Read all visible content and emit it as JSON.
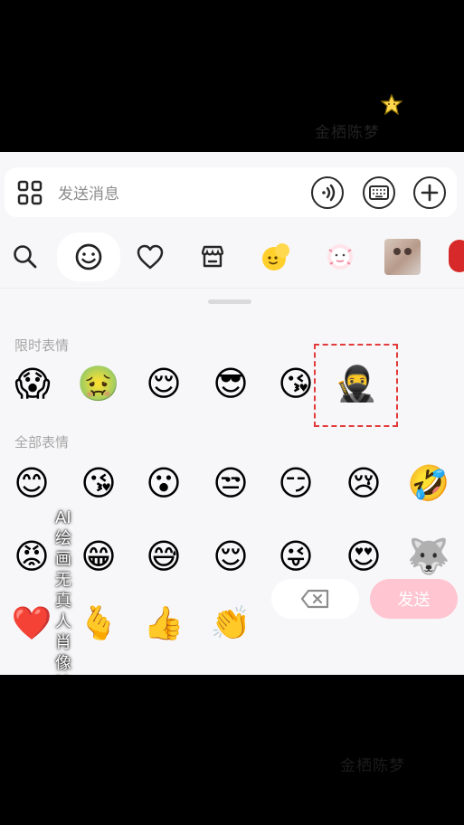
{
  "watermark": {
    "top": "金栖陈梦",
    "bottom": "金栖陈梦"
  },
  "overlay_caption": "AI绘画无真人肖像输入",
  "composer": {
    "placeholder": "发送消息",
    "icons": {
      "apps": "apps-grid-icon",
      "voice": "voice-icon",
      "keyboard": "keyboard-icon",
      "plus": "plus-icon"
    }
  },
  "categories": [
    {
      "name": "search",
      "icon": "search-icon"
    },
    {
      "name": "emoji",
      "icon": "smile-icon"
    },
    {
      "name": "favorites",
      "icon": "heart-icon"
    },
    {
      "name": "store",
      "icon": "shop-icon"
    },
    {
      "name": "sticker-1",
      "icon": "yellow-sticker-icon"
    },
    {
      "name": "sticker-2",
      "icon": "pink-sticker-icon"
    },
    {
      "name": "sticker-3",
      "icon": "cat-photo-icon"
    },
    {
      "name": "sticker-4",
      "icon": "red-sticker-icon"
    }
  ],
  "sections": {
    "limited": "限时表情",
    "all": "全部表情"
  },
  "limited_emojis": [
    "😱",
    "🤢",
    "😌",
    "😎",
    "😘",
    "🥷"
  ],
  "all_emojis": {
    "row_1": [
      "😊",
      "😘",
      "😮",
      "😒",
      "😏",
      "😢",
      "🤣"
    ],
    "row_2": [
      "😡",
      "😁",
      "😅",
      "😌",
      "😜",
      "😍",
      "🐺"
    ],
    "row_3": [
      "❤️",
      "🫰",
      "👍",
      "👏"
    ]
  },
  "actions": {
    "send": "发送",
    "delete_icon": "backspace-icon"
  },
  "colors": {
    "send_disabled": "#ffc5d1",
    "selection_outline": "#e23b3b"
  }
}
